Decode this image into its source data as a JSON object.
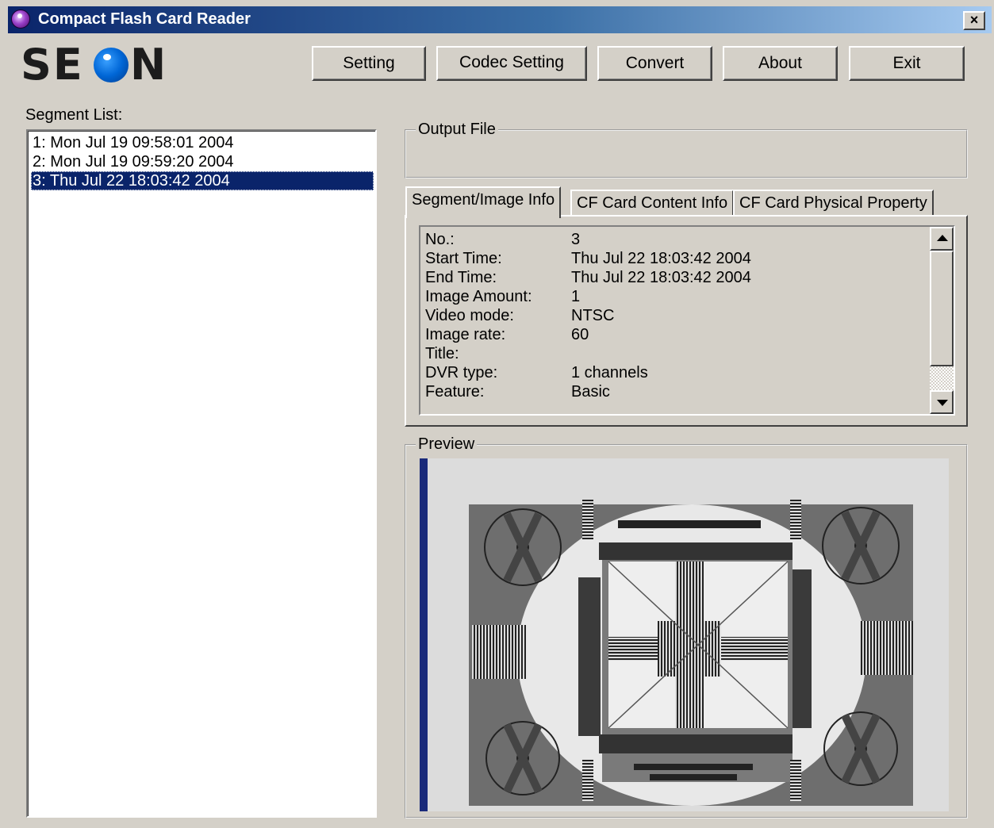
{
  "window": {
    "title": "Compact Flash Card Reader",
    "close_glyph": "×"
  },
  "logo": {
    "text_left": "SE",
    "text_right": "N"
  },
  "toolbar": {
    "setting": "Setting",
    "codec_setting": "Codec Setting",
    "convert": "Convert",
    "about": "About",
    "exit": "Exit"
  },
  "segments": {
    "label": "Segment List:",
    "items": [
      "1: Mon Jul 19 09:58:01 2004",
      "2: Mon Jul 19 09:59:20 2004",
      "3: Thu Jul 22 18:03:42 2004"
    ],
    "selected_index": 2
  },
  "output_file": {
    "label": "Output File",
    "value": ""
  },
  "tabs": [
    "Segment/Image Info",
    "CF Card Content Info",
    "CF Card Physical Property"
  ],
  "active_tab": 0,
  "info": [
    {
      "key": "No.:",
      "value": "3"
    },
    {
      "key": "Start Time:",
      "value": "Thu Jul 22 18:03:42 2004"
    },
    {
      "key": "End Time:",
      "value": "Thu Jul 22 18:03:42 2004"
    },
    {
      "key": "Image Amount:",
      "value": "1"
    },
    {
      "key": "Video mode:",
      "value": "NTSC"
    },
    {
      "key": "Image rate:",
      "value": "60"
    },
    {
      "key": "Title:",
      "value": ""
    },
    {
      "key": "DVR type:",
      "value": "1 channels"
    },
    {
      "key": "Feature:",
      "value": "Basic"
    }
  ],
  "preview": {
    "label": "Preview"
  },
  "icons": {
    "app": "app-disc-icon",
    "close": "close-icon",
    "scroll_up": "scroll-up-arrow-icon",
    "scroll_down": "scroll-down-arrow-icon"
  },
  "colors": {
    "title_start": "#0a246a",
    "title_end": "#a6caf0",
    "selection": "#0a246a",
    "face": "#d4d0c8",
    "logo_blue": "#0066d6"
  }
}
